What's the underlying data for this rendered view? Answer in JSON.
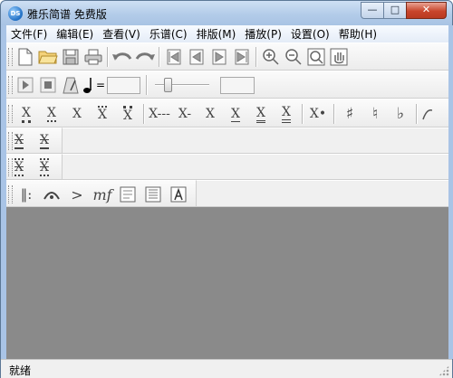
{
  "window": {
    "title": "雅乐简谱 免费版",
    "app_icon_text": "DS",
    "controls": {
      "minimize": "—",
      "maximize": "□",
      "close": "✕"
    }
  },
  "menu": [
    "文件(F)",
    "编辑(E)",
    "查看(V)",
    "乐谱(C)",
    "排版(M)",
    "播放(P)",
    "设置(O)",
    "帮助(H)"
  ],
  "toolbar_main": {
    "file_icons": [
      "new-file-icon",
      "open-folder-icon",
      "save-disk-icon",
      "print-icon"
    ],
    "edit_icons": [
      "undo-icon",
      "redo-icon"
    ],
    "nav_icons": [
      "first-page-icon",
      "prev-page-icon",
      "next-page-icon",
      "last-page-icon"
    ],
    "view_icons": [
      "zoom-in-icon",
      "zoom-out-icon",
      "fit-page-icon",
      "hand-pan-icon"
    ]
  },
  "playback": {
    "tempo_equals": "=",
    "tempo_value": "",
    "position_value": ""
  },
  "notes": {
    "row1": [
      "X",
      "X",
      "X",
      "X",
      "X",
      "X---",
      "X-",
      "X",
      "X",
      "X",
      "X",
      "X•",
      "♯",
      "♮",
      "♭"
    ],
    "row2": [
      "X",
      "X"
    ],
    "row3": [
      "X",
      "X"
    ],
    "row4_symbols": [
      "‖:",
      "𝄐",
      ">",
      "mf"
    ]
  },
  "status": {
    "text": "就绪"
  }
}
